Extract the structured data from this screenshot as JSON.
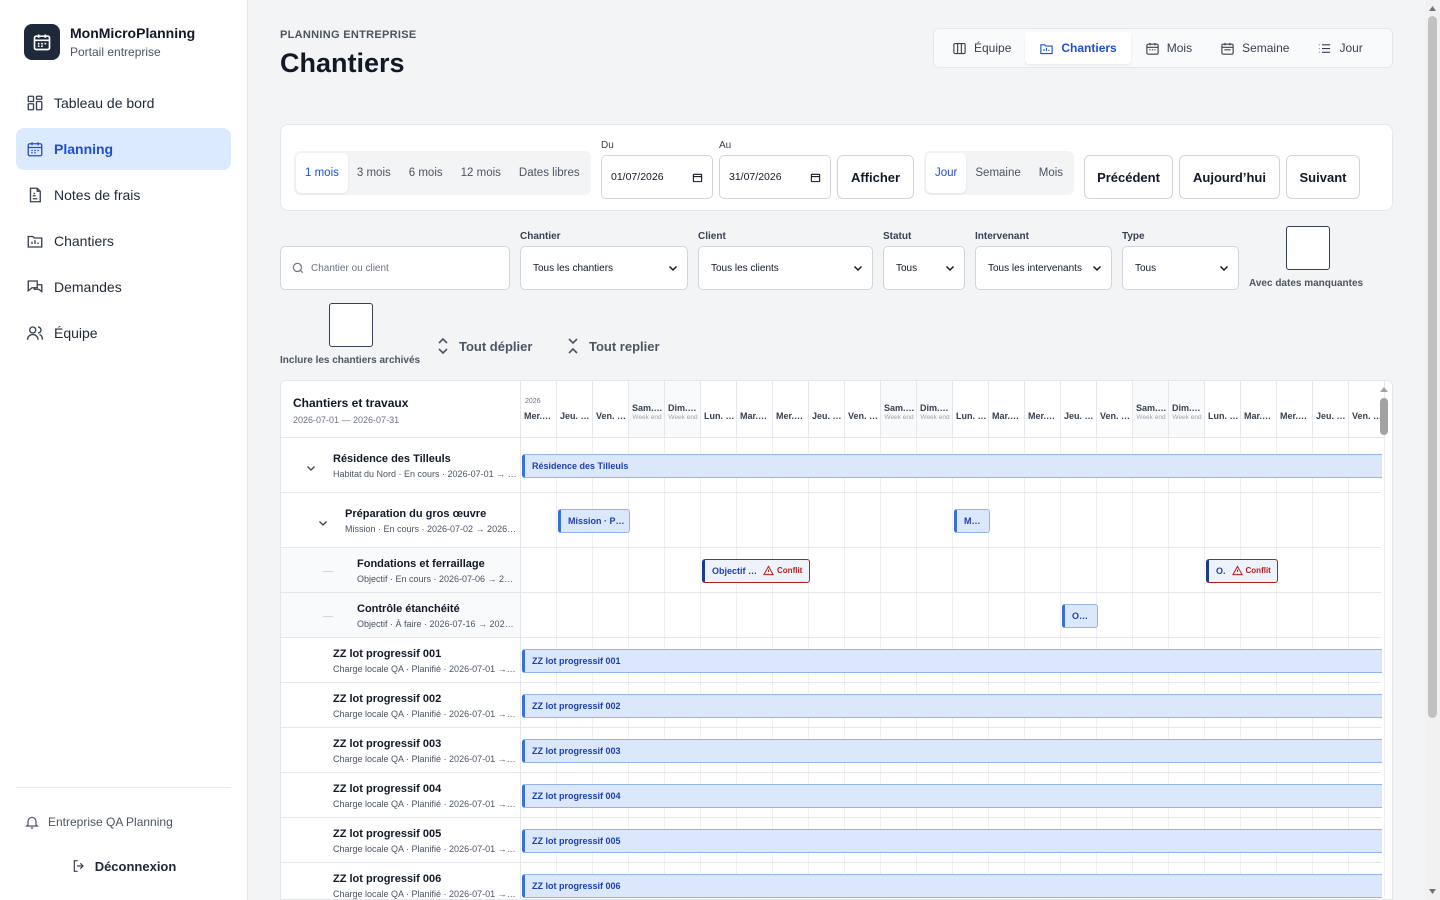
{
  "brand": {
    "name": "MonMicroPlanning",
    "subtitle": "Portail entreprise"
  },
  "nav": [
    {
      "label": "Tableau de bord",
      "icon": "dashboard-icon"
    },
    {
      "label": "Planning",
      "icon": "calendar-icon",
      "active": true
    },
    {
      "label": "Notes de frais",
      "icon": "receipt-icon"
    },
    {
      "label": "Chantiers",
      "icon": "folder-chart-icon"
    },
    {
      "label": "Demandes",
      "icon": "messages-icon"
    },
    {
      "label": "Équipe",
      "icon": "users-icon"
    }
  ],
  "org": "Entreprise QA Planning",
  "logout": "Déconnexion",
  "header": {
    "eyebrow": "PLANNING ENTREPRISE",
    "title": "Chantiers"
  },
  "views": [
    {
      "label": "Équipe",
      "icon": "columns-icon"
    },
    {
      "label": "Chantiers",
      "icon": "folder-chart-icon",
      "active": true
    },
    {
      "label": "Mois",
      "icon": "calendar-icon"
    },
    {
      "label": "Semaine",
      "icon": "calendar-icon"
    },
    {
      "label": "Jour",
      "icon": "list-icon"
    }
  ],
  "period": {
    "ranges": [
      "1 mois",
      "3 mois",
      "6 mois",
      "12 mois",
      "Dates libres"
    ],
    "from_label": "Du",
    "from_value": "01/07/2026",
    "to_label": "Au",
    "to_value": "31/07/2026",
    "show": "Afficher",
    "granularity": [
      "Jour",
      "Semaine",
      "Mois"
    ],
    "prev": "Précédent",
    "today": "Aujourd’hui",
    "next": "Suivant"
  },
  "filters": {
    "search_placeholder": "Chantier ou client",
    "chantier_label": "Chantier",
    "chantier_value": "Tous les chantiers",
    "client_label": "Client",
    "client_value": "Tous les clients",
    "statut_label": "Statut",
    "statut_value": "Tous",
    "intervenant_label": "Intervenant",
    "intervenant_value": "Tous les intervenants",
    "type_label": "Type",
    "type_value": "Tous",
    "missing_dates": "Avec dates manquantes",
    "archived": "Inclure les chantiers archivés",
    "expand_all": "Tout déplier",
    "collapse_all": "Tout replier"
  },
  "gantt": {
    "title": "Chantiers et travaux",
    "range": "2026-07-01 — 2026-07-31",
    "year": "2026",
    "weekend_label": "Week end",
    "days": [
      "Mer.…",
      "Jeu. …",
      "Ven. …",
      "Sam.…",
      "Dim.…",
      "Lun. …",
      "Mar.…",
      "Mer.…",
      "Jeu. …",
      "Ven. …",
      "Sam.…",
      "Dim.…",
      "Lun. …",
      "Mar.…",
      "Mer.…",
      "Jeu. …",
      "Ven. …",
      "Sam.…",
      "Dim.…",
      "Lun. …",
      "Mar.…",
      "Mer.…",
      "Jeu. …",
      "Ven. …"
    ],
    "rows": [
      {
        "name": "Résidence des Tilleuls",
        "meta": "Habitat du Nord · En cours · 2026-07-01 → …",
        "bar": "Résidence des Tilleuls"
      },
      {
        "name": "Préparation du gros œuvre",
        "meta": "Mission · En cours · 2026-07-02 → 2026-…",
        "bars": [
          "Mission · P…",
          "M…"
        ]
      },
      {
        "name": "Fondations et ferraillage",
        "meta": "Objectif · En cours · 2026-07-06 → 20…",
        "bars": [
          "Objectif …",
          "O."
        ],
        "conflict": "Conflit"
      },
      {
        "name": "Contrôle étanchéité",
        "meta": "Objectif · À faire · 2026-07-16 → 202…",
        "bars": [
          "O…"
        ]
      },
      {
        "name": "ZZ lot progressif 001",
        "meta": "Charge locale QA · Planifié · 2026-07-01 → …",
        "bar": "ZZ lot progressif 001"
      },
      {
        "name": "ZZ lot progressif 002",
        "meta": "Charge locale QA · Planifié · 2026-07-01 → …",
        "bar": "ZZ lot progressif 002"
      },
      {
        "name": "ZZ lot progressif 003",
        "meta": "Charge locale QA · Planifié · 2026-07-01 → …",
        "bar": "ZZ lot progressif 003"
      },
      {
        "name": "ZZ lot progressif 004",
        "meta": "Charge locale QA · Planifié · 2026-07-01 → …",
        "bar": "ZZ lot progressif 004"
      },
      {
        "name": "ZZ lot progressif 005",
        "meta": "Charge locale QA · Planifié · 2026-07-01 → …",
        "bar": "ZZ lot progressif 005"
      },
      {
        "name": "ZZ lot progressif 006",
        "meta": "Charge locale QA · Planifié · 2026-07-01 → …",
        "bar": "ZZ lot progressif 006"
      }
    ]
  }
}
